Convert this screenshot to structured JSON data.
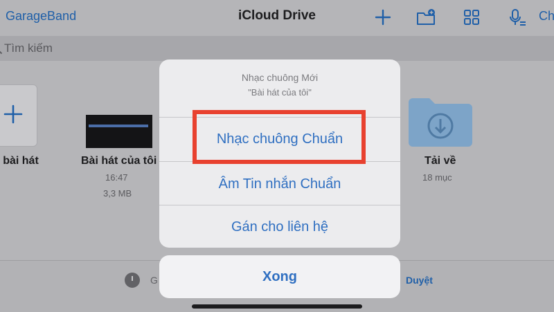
{
  "nav": {
    "back_label": "GarageBand",
    "title": "iCloud Drive",
    "extra_label": "Ch",
    "icons": [
      "plus-icon",
      "folder-add-icon",
      "grid-icon",
      "mic-icon"
    ]
  },
  "search": {
    "placeholder": "Tìm kiếm"
  },
  "files": {
    "create_label": "o bài hát",
    "song": {
      "name": "Bài hát của tôi",
      "time": "16:47",
      "size": "3,3 MB"
    },
    "folder": {
      "name": "Tải về",
      "count": "18 mục"
    }
  },
  "tabbar": {
    "recent_label": "G",
    "browse_label": "Duyệt"
  },
  "sheet": {
    "title": "Nhạc chuông Mới",
    "subtitle": "\"Bài hát của tôi\"",
    "actions": [
      "Nhạc chuông Chuẩn",
      "Âm Tin nhắn Chuẩn",
      "Gán cho liên hệ"
    ],
    "done_label": "Xong"
  },
  "colors": {
    "accent": "#2f6fc1",
    "highlight": "#e8412f"
  }
}
